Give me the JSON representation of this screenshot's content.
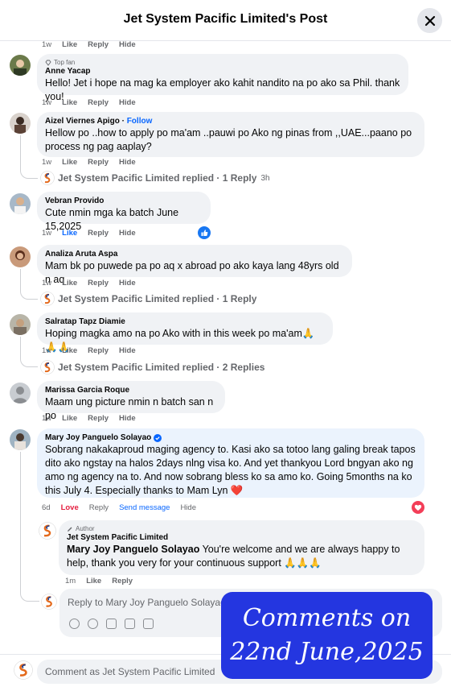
{
  "header": {
    "title": "Jet System Pacific Limited's Post"
  },
  "common": {
    "like": "Like",
    "reply": "Reply",
    "hide": "Hide",
    "love": "Love",
    "send_message": "Send message"
  },
  "top": {
    "time": "1w"
  },
  "comments": [
    {
      "badge": "Top fan",
      "name": "Anne Yacap",
      "text": "Hello! Jet i hope na mag ka employer ako kahit nandito na po ako sa Phil. thank you!",
      "time": "1w"
    },
    {
      "name": "Aizel Viernes Apigo",
      "follow": "Follow",
      "text": "Hellow po ..how to apply po ma'am ..pauwi po Ako ng pinas from ,,UAE...paano po process ng pag aaplay?",
      "time": "1w",
      "replied": "Jet System Pacific Limited replied · 1 Reply",
      "replied_time": "3h"
    },
    {
      "name": "Vebran Provido",
      "text": "Cute nmin mga ka batch June 15,2025",
      "time": "1w"
    },
    {
      "name": "Analiza Aruta Aspa",
      "text": "Mam bk po puwede pa po aq x abroad po ako kaya lang 48yrs old n aq",
      "time": "1w",
      "replied": "Jet System Pacific Limited replied · 1 Reply"
    },
    {
      "name": "Salratap Tapz Diamie",
      "text": "Hoping magka amo na po Ako with in this week po ma'am🙏🙏🙏",
      "time": "1w",
      "replied": "Jet System Pacific Limited replied · 2 Replies"
    },
    {
      "name": "Marissa Garcia Roque",
      "text": "Maam ung picture nmin n batch san n po",
      "time": "1w"
    },
    {
      "name": "Mary Joy Panguelo Solayao",
      "text": "Sobrang nakakaproud maging agency to. Kasi ako sa totoo lang galing break tapos dito ako ngstay na halos 2days nlng visa ko. And yet thankyou Lord bngyan ako ng amo ng agency na to. And now sobrang bless ko sa amo ko. Going 5months na ko this July 4. Especially thanks to Mam Lyn ❤️",
      "time": "6d"
    }
  ],
  "author_reply": {
    "badge": "Author",
    "name": "Jet System Pacific Limited",
    "mention": "Mary Joy Panguelo Solayao",
    "text": " You're welcome and we are always happy to help, thank you very for your continuous support 🙏🙏🙏",
    "time": "1m"
  },
  "reply_input": {
    "placeholder": "Reply to Mary Joy Panguelo Solayao"
  },
  "bottom": {
    "placeholder": "Comment as Jet System Pacific Limited"
  },
  "overlay": {
    "line1": "Comments on",
    "line2": "22nd June,2025"
  },
  "colors": {
    "accent": "#0866ff",
    "love": "#e41e3f",
    "overlay": "#2436e0"
  }
}
